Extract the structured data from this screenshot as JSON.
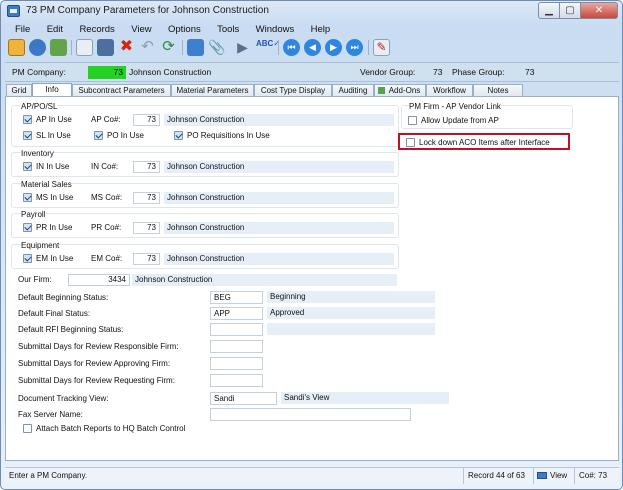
{
  "window": {
    "title": "73 PM Company Parameters for Johnson Construction"
  },
  "menu": [
    "File",
    "Edit",
    "Records",
    "View",
    "Options",
    "Tools",
    "Windows",
    "Help"
  ],
  "header": {
    "pm_company_label": "PM Company:",
    "pm_company_value": "73",
    "pm_company_name": "Johnson Construction",
    "vendor_group_label": "Vendor Group:",
    "vendor_group_value": "73",
    "phase_group_label": "Phase Group:",
    "phase_group_value": "73"
  },
  "tabs": [
    "Grid",
    "Info",
    "Subcontract Parameters",
    "Material Parameters",
    "Cost Type Display",
    "Auditing",
    "Add-Ons",
    "Workflow",
    "Notes"
  ],
  "active_tab": "Info",
  "ap": {
    "title": "AP/PO/SL",
    "ap_in_use": "AP In Use",
    "ap_co_label": "AP Co#:",
    "ap_co": "73",
    "ap_name": "Johnson Construction",
    "sl_in_use": "SL In Use",
    "po_in_use": "PO In Use",
    "po_req": "PO Requisitions In Use"
  },
  "inventory": {
    "title": "Inventory",
    "in_use": "IN In Use",
    "co_label": "IN Co#:",
    "co": "73",
    "name": "Johnson Construction"
  },
  "material_sales": {
    "title": "Material Sales",
    "in_use": "MS In Use",
    "co_label": "MS Co#:",
    "co": "73",
    "name": "Johnson Construction"
  },
  "payroll": {
    "title": "Payroll",
    "in_use": "PR In Use",
    "co_label": "PR Co#:",
    "co": "73",
    "name": "Johnson Construction"
  },
  "equipment": {
    "title": "Equipment",
    "in_use": "EM In Use",
    "co_label": "EM Co#:",
    "co": "73",
    "name": "Johnson Construction"
  },
  "pm_firm": {
    "title": "PM Firm - AP Vendor Link",
    "allow_update": "Allow Update from AP",
    "lock_down": "Lock down ACO Items after Interface"
  },
  "our_firm": {
    "label": "Our Firm:",
    "value": "3434",
    "name": "Johnson Construction"
  },
  "fields": {
    "def_begin_label": "Default Beginning Status:",
    "def_begin_code": "BEG",
    "def_begin_desc": "Beginning",
    "def_final_label": "Default Final Status:",
    "def_final_code": "APP",
    "def_final_desc": "Approved",
    "def_rfi_label": "Default RFI Beginning Status:",
    "sub_resp_label": "Submittal Days for Review Responsible Firm:",
    "sub_appr_label": "Submittal Days for Review Approving Firm:",
    "sub_req_label": "Submittal Days for Review Requesting Firm:",
    "doc_track_label": "Document Tracking View:",
    "doc_track_code": "Sandi",
    "doc_track_desc": "Sandi's View",
    "fax_label": "Fax Server Name:",
    "attach_batch": "Attach Batch Reports to HQ Batch Control"
  },
  "status": {
    "message": "Enter a PM Company.",
    "record": "Record 44 of 63",
    "view": "View",
    "co": "Co#: 73"
  }
}
